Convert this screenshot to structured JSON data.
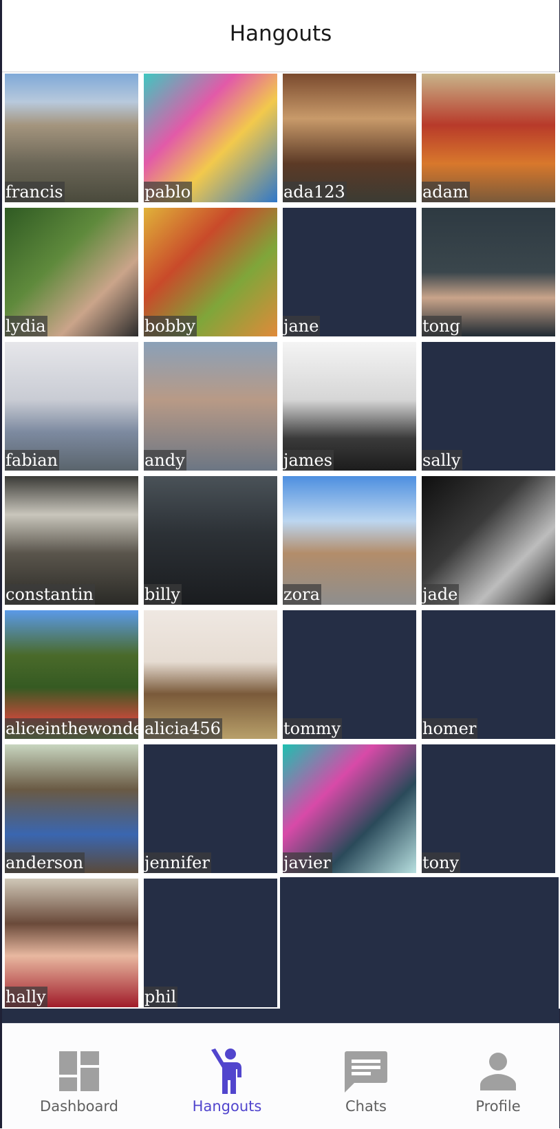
{
  "header": {
    "title": "Hangouts"
  },
  "hangouts": [
    {
      "name": "francis",
      "photo": true
    },
    {
      "name": "pablo",
      "photo": true
    },
    {
      "name": "ada123",
      "photo": true
    },
    {
      "name": "adam",
      "photo": true
    },
    {
      "name": "lydia",
      "photo": true
    },
    {
      "name": "bobby",
      "photo": true
    },
    {
      "name": "jane",
      "photo": false
    },
    {
      "name": "tong",
      "photo": true
    },
    {
      "name": "fabian",
      "photo": true
    },
    {
      "name": "andy",
      "photo": true
    },
    {
      "name": "james",
      "photo": true
    },
    {
      "name": "sally",
      "photo": false
    },
    {
      "name": "constantin",
      "photo": true
    },
    {
      "name": "billy",
      "photo": true
    },
    {
      "name": "zora",
      "photo": true
    },
    {
      "name": "jade",
      "photo": true
    },
    {
      "name": "aliceinthewonde",
      "photo": true
    },
    {
      "name": "alicia456",
      "photo": true
    },
    {
      "name": "tommy",
      "photo": false
    },
    {
      "name": "homer",
      "photo": false
    },
    {
      "name": "anderson",
      "photo": true
    },
    {
      "name": "jennifer",
      "photo": false
    },
    {
      "name": "javier",
      "photo": true
    },
    {
      "name": "tony",
      "photo": false
    },
    {
      "name": "hally",
      "photo": true
    },
    {
      "name": "phil",
      "photo": false
    }
  ],
  "tabs": [
    {
      "label": "Dashboard",
      "icon": "dashboard-icon",
      "active": false
    },
    {
      "label": "Hangouts",
      "icon": "person-waving-icon",
      "active": true
    },
    {
      "label": "Chats",
      "icon": "chat-bubble-icon",
      "active": false
    },
    {
      "label": "Profile",
      "icon": "person-icon",
      "active": false
    }
  ],
  "colors": {
    "accent": "#5145cd",
    "tile_empty": "#252e45",
    "tab_inactive": "#5f5f5f",
    "icon_inactive": "#a0a0a0"
  }
}
